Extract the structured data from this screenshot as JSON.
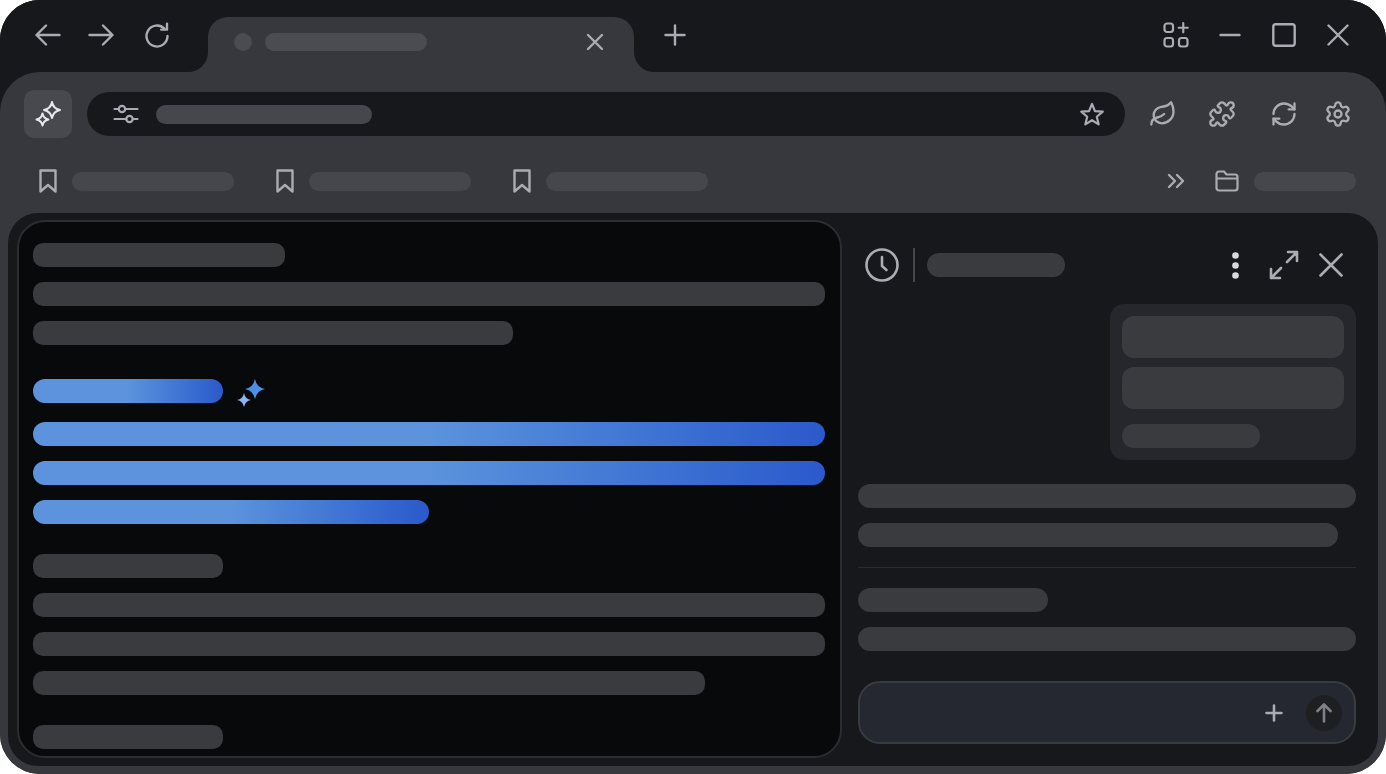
{
  "tabs": [
    {
      "selected": true
    }
  ],
  "toolbar": {
    "assistant_button": {
      "active": true
    }
  },
  "page": {
    "lines": [
      {
        "kind": "heading"
      },
      {
        "kind": "text"
      },
      {
        "kind": "text"
      },
      {
        "kind": "ai_heading"
      },
      {
        "kind": "ai_text"
      },
      {
        "kind": "ai_text"
      },
      {
        "kind": "ai_text"
      },
      {
        "kind": "heading"
      },
      {
        "kind": "text"
      },
      {
        "kind": "text"
      },
      {
        "kind": "text"
      },
      {
        "kind": "heading"
      }
    ]
  },
  "side_panel": {
    "composer": {
      "send_button": {
        "disabled": true
      }
    }
  }
}
